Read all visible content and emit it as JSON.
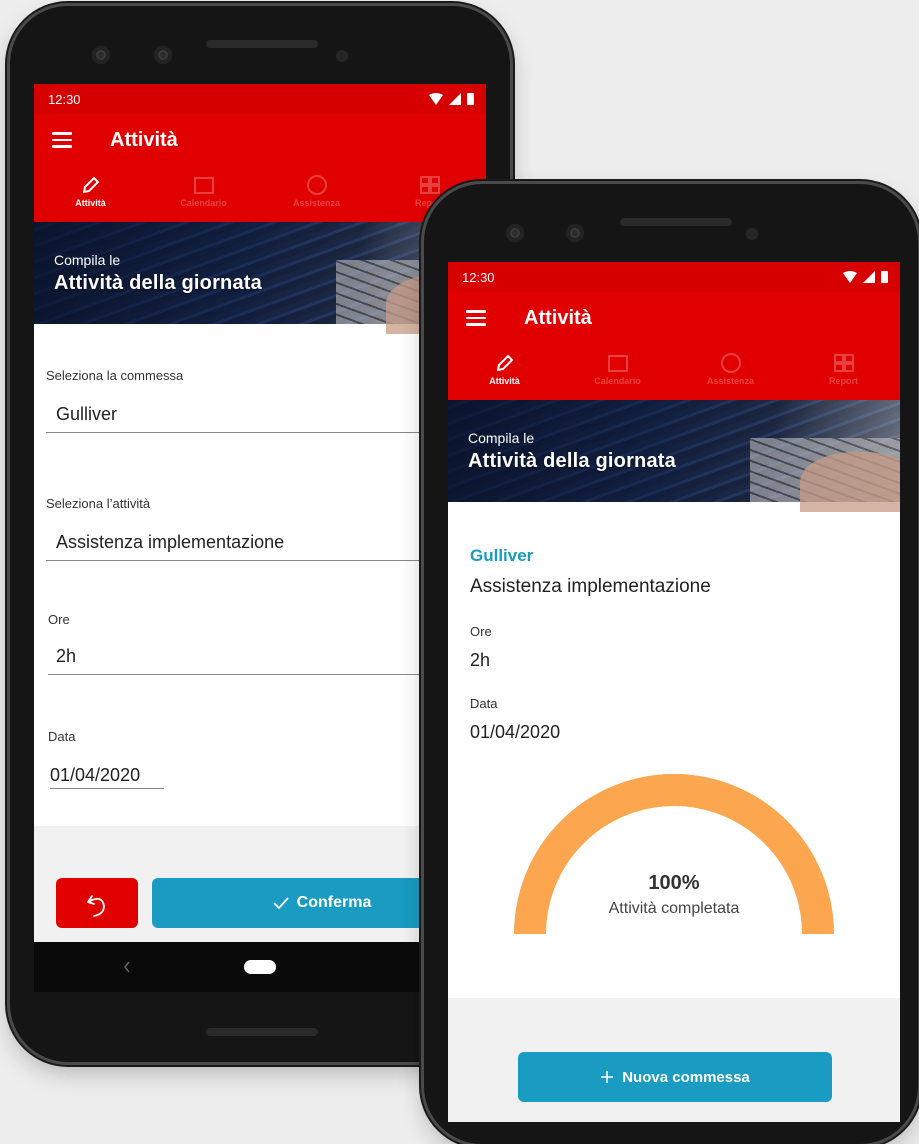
{
  "back_phone": {
    "status_time": "12:30",
    "app_title": "Attività",
    "tabs": [
      {
        "label": "Attività",
        "icon": "pencil-icon",
        "active": true
      },
      {
        "label": "Calendario",
        "icon": "calendar-icon",
        "active": false
      },
      {
        "label": "Assistenza",
        "icon": "help-icon",
        "active": false
      },
      {
        "label": "Report",
        "icon": "grid-icon",
        "active": false
      }
    ],
    "hero": {
      "subtitle": "Compila le",
      "title": "Attività della giornata"
    },
    "form": {
      "commessa_label": "Seleziona la commessa",
      "commessa_value": "Gulliver",
      "attivita_label": "Seleziona l’attività",
      "attivita_value": "Assistenza implementazione",
      "ore_label": "Ore",
      "ore_value": "2h",
      "data_label": "Data",
      "data_value": "01/04/2020"
    },
    "confirm_label": "Conferma"
  },
  "front_phone": {
    "status_time": "12:30",
    "app_title": "Attività",
    "tabs": [
      {
        "label": "Attività",
        "icon": "pencil-icon",
        "active": true
      },
      {
        "label": "Calendario",
        "icon": "calendar-icon",
        "active": false
      },
      {
        "label": "Assistenza",
        "icon": "help-icon",
        "active": false
      },
      {
        "label": "Report",
        "icon": "grid-icon",
        "active": false
      }
    ],
    "hero": {
      "subtitle": "Compila le",
      "title": "Attività della giornata"
    },
    "summary": {
      "commessa": "Gulliver",
      "attivita": "Assistenza implementazione",
      "ore_label": "Ore",
      "ore_value": "2h",
      "data_label": "Data",
      "data_value": "01/04/2020"
    },
    "gauge": {
      "percent_text": "100%",
      "caption": "Attività completata",
      "fraction": 1.0
    },
    "new_button_label": "Nuova commessa"
  },
  "colors": {
    "red": "#e10000",
    "blue": "#1a9bc2",
    "gauge_orange": "#fca64f",
    "accent_teal": "#1a9bc2"
  }
}
